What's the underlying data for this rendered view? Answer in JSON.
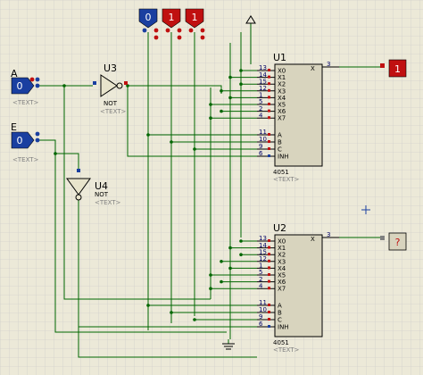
{
  "inputs": {
    "A": {
      "name": "A",
      "value": "0"
    },
    "E": {
      "name": "E",
      "value": "0"
    }
  },
  "selectors": [
    {
      "value": "0"
    },
    {
      "value": "1"
    },
    {
      "value": "1"
    }
  ],
  "gates": {
    "U3": {
      "ref": "U3",
      "type": "NOT",
      "text": "<TEXT>"
    },
    "U4": {
      "ref": "U4",
      "type": "NOT",
      "text": "<TEXT>"
    }
  },
  "label_text": "<TEXT>",
  "muxes": {
    "U1": {
      "ref": "U1",
      "part": "4051",
      "text": "<TEXT>",
      "output_pin": "3",
      "output_label": "X",
      "data_pins": [
        {
          "num": "13",
          "name": "X0"
        },
        {
          "num": "14",
          "name": "X1"
        },
        {
          "num": "15",
          "name": "X2"
        },
        {
          "num": "12",
          "name": "X3"
        },
        {
          "num": "1",
          "name": "X4"
        },
        {
          "num": "5",
          "name": "X5"
        },
        {
          "num": "2",
          "name": "X6"
        },
        {
          "num": "4",
          "name": "X7"
        }
      ],
      "ctrl_pins": [
        {
          "num": "11",
          "name": "A"
        },
        {
          "num": "10",
          "name": "B"
        },
        {
          "num": "9",
          "name": "C"
        },
        {
          "num": "6",
          "name": "INH"
        }
      ]
    },
    "U2": {
      "ref": "U2",
      "part": "4051",
      "text": "<TEXT>",
      "output_pin": "3",
      "output_label": "X",
      "data_pins": [
        {
          "num": "13",
          "name": "X0"
        },
        {
          "num": "14",
          "name": "X1"
        },
        {
          "num": "15",
          "name": "X2"
        },
        {
          "num": "12",
          "name": "X3"
        },
        {
          "num": "1",
          "name": "X4"
        },
        {
          "num": "5",
          "name": "X5"
        },
        {
          "num": "2",
          "name": "X6"
        },
        {
          "num": "4",
          "name": "X7"
        }
      ],
      "ctrl_pins": [
        {
          "num": "11",
          "name": "A"
        },
        {
          "num": "10",
          "name": "B"
        },
        {
          "num": "9",
          "name": "C"
        },
        {
          "num": "6",
          "name": "INH"
        }
      ]
    }
  },
  "outputs": {
    "out1": {
      "value": "1"
    },
    "out2": {
      "value": "?"
    }
  },
  "colors": {
    "background": "#ece9d8",
    "grid": "#c8c8c8",
    "wire": "#006600",
    "component": "#000000",
    "ic_fill": "#d8d4be",
    "logic_low": "#1a3fa0",
    "logic_high": "#c01010",
    "pin_text": "#000066",
    "label_grey": "#808080"
  }
}
